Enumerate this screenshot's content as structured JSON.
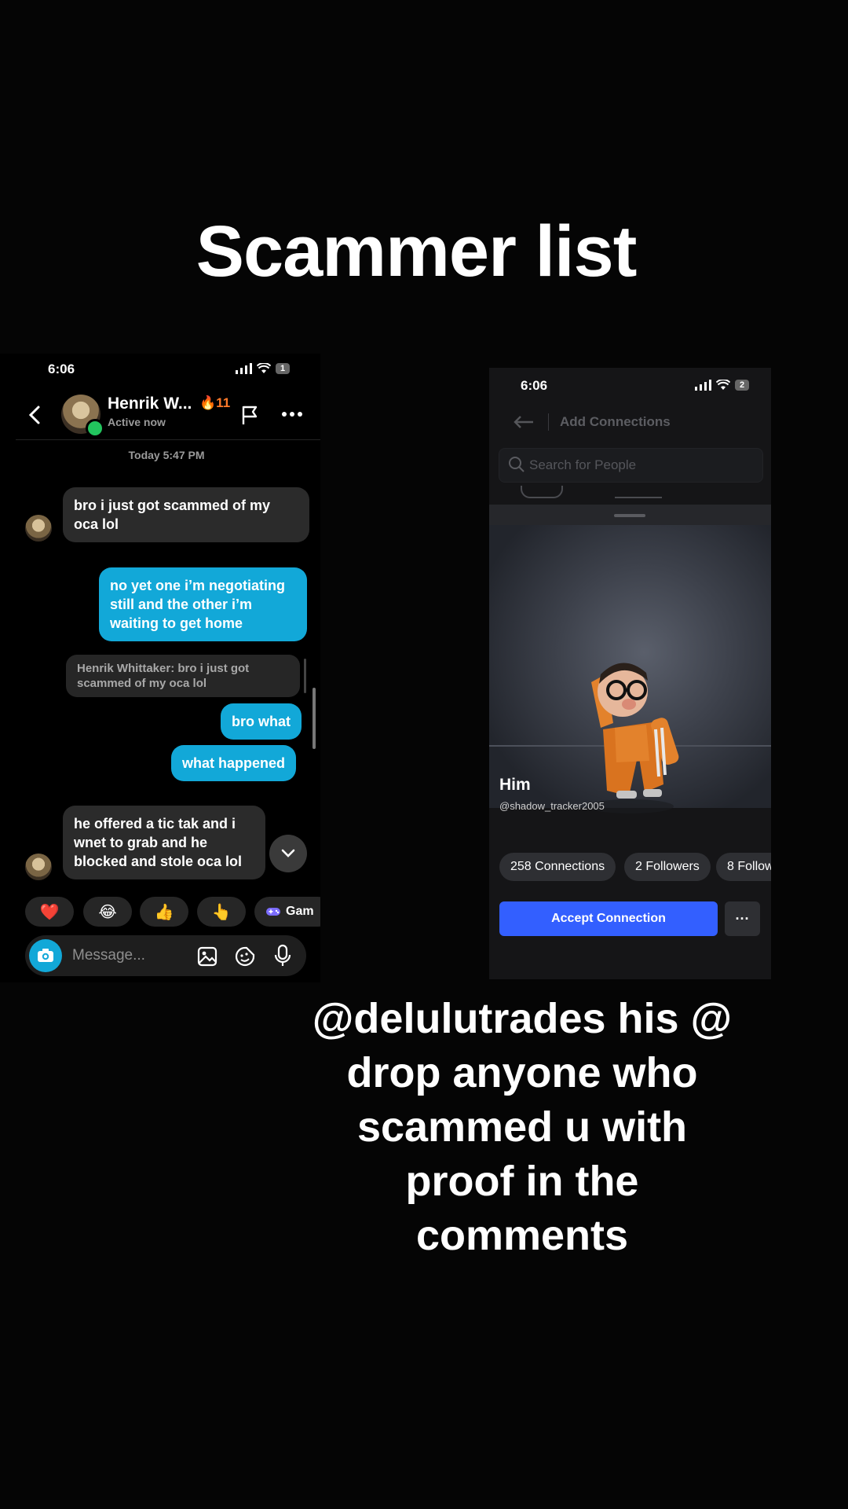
{
  "title": "Scammer list",
  "caption": "@delulutrades his @ drop anyone who scammed u with proof in the comments",
  "chat": {
    "status": {
      "time": "6:06",
      "battery": "1"
    },
    "header": {
      "name": "Henrik W...",
      "streak": "🔥5️⃣1",
      "streak_text": "11",
      "active": "Active now"
    },
    "date_label": "Today 5:47 PM",
    "messages": [
      {
        "dir": "in",
        "text": "bro i just got scammed of my oca lol"
      },
      {
        "dir": "out",
        "text": "no yet one i’m negotiating still and the other i’m waiting to get home"
      },
      {
        "dir": "reply",
        "text": "Henrik Whittaker: bro i just got scammed of my oca lol"
      },
      {
        "dir": "out",
        "text": "bro what"
      },
      {
        "dir": "out",
        "text": "what happened"
      },
      {
        "dir": "in",
        "text": "he offered a tic tak and i wnet to grab and he blocked and stole oca lol"
      }
    ],
    "reactions": [
      "❤️",
      "😂",
      "👍",
      "👆"
    ],
    "games_label": "Gam",
    "composer_placeholder": "Message...",
    "icons": [
      "back-icon",
      "flag-icon",
      "more-icon",
      "camera-icon",
      "gallery-icon",
      "sticker-icon",
      "mic-icon",
      "chevron-down-icon",
      "gamepad-icon"
    ]
  },
  "profile": {
    "status": {
      "time": "6:06",
      "battery": "2"
    },
    "header_title": "Add Connections",
    "search_placeholder": "Search for People",
    "display_name": "Him",
    "username": "@shadow_tracker2005",
    "stats": [
      "258 Connections",
      "2 Followers",
      "8 Follow"
    ],
    "accept_label": "Accept Connection",
    "more_label": "···",
    "accent": "#335fff"
  }
}
